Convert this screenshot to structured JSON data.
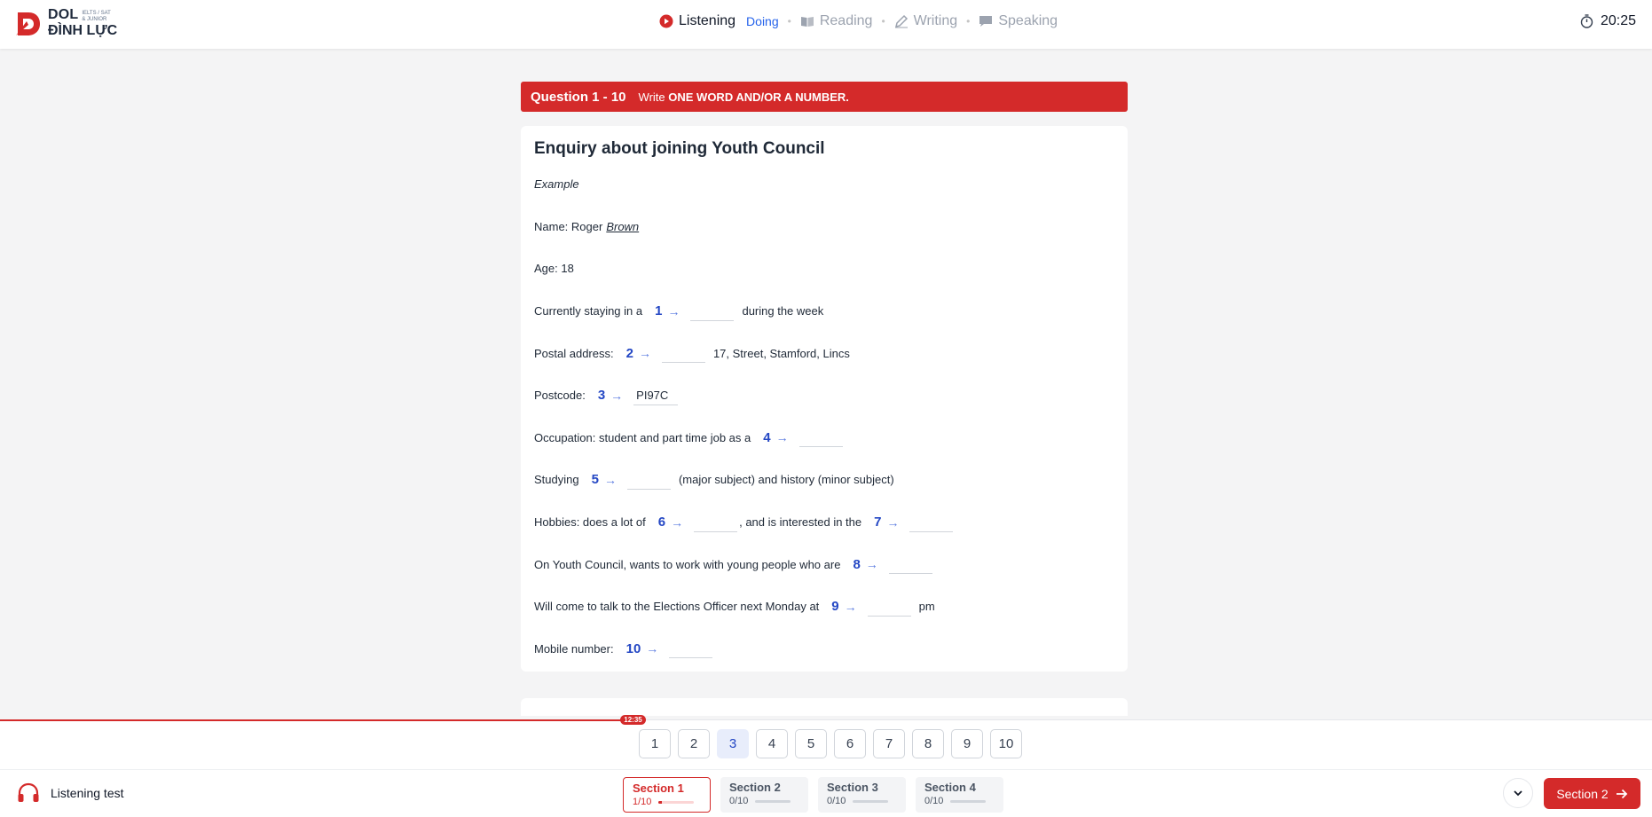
{
  "brand": {
    "name_line1": "DOL",
    "tag_line1": "IELTS / SAT",
    "tag_line2": "& JUNIOR",
    "name_line2": "ĐÌNH LỰC"
  },
  "skills": [
    {
      "label": "Listening",
      "status": "Doing",
      "icon": "play-circle-icon",
      "active": true
    },
    {
      "label": "Reading",
      "icon": "book-icon",
      "active": false
    },
    {
      "label": "Writing",
      "icon": "pencil-icon",
      "active": false
    },
    {
      "label": "Speaking",
      "icon": "chat-icon",
      "active": false
    }
  ],
  "timer": {
    "icon": "stopwatch-icon",
    "value": "20:25"
  },
  "question_block": {
    "range": "Question 1 - 10",
    "instruction_prefix": "Write",
    "instruction_bold": "ONE WORD AND/OR A NUMBER."
  },
  "form": {
    "title": "Enquiry about joining Youth Council",
    "example_label": "Example",
    "name_prefix": "Name: Roger",
    "name_example": "Brown",
    "age": "Age: 18",
    "q1_before": "Currently staying in a",
    "q1_after": "during the week",
    "q2_before": "Postal address:",
    "q2_after": "17,  Street, Stamford, Lincs",
    "q3_before": "Postcode:",
    "q3_value": "PI97C",
    "q4_before": "Occupation: student and part time job as a",
    "q5_before": "Studying",
    "q5_after": "(major subject) and history (minor subject)",
    "q6_before": "Hobbies: does a lot of",
    "q6_after": ", and is interested in the",
    "q8_before": "On Youth Council, wants to work with young people who are",
    "q9_before": "Will come to talk to the Elections Officer next Monday at",
    "q9_after": "pm",
    "q10_before": "Mobile number:",
    "numbers": [
      "1",
      "2",
      "3",
      "4",
      "5",
      "6",
      "7",
      "8",
      "9",
      "10"
    ],
    "arrow": "→"
  },
  "audio_progress": {
    "time_badge": "12:35",
    "fraction": 0.383
  },
  "question_nav": [
    "1",
    "2",
    "3",
    "4",
    "5",
    "6",
    "7",
    "8",
    "9",
    "10"
  ],
  "current_question": "3",
  "footer": {
    "test_label": "Listening test",
    "sections": [
      {
        "title": "Section 1",
        "count": "1/10",
        "progress": 0.1,
        "active": true
      },
      {
        "title": "Section 2",
        "count": "0/10",
        "progress": 0,
        "active": false
      },
      {
        "title": "Section 3",
        "count": "0/10",
        "progress": 0,
        "active": false
      },
      {
        "title": "Section 4",
        "count": "0/10",
        "progress": 0,
        "active": false
      }
    ],
    "next_label": "Section 2",
    "colors": {
      "accent": "#d42a2a",
      "link": "#2447c4"
    }
  }
}
